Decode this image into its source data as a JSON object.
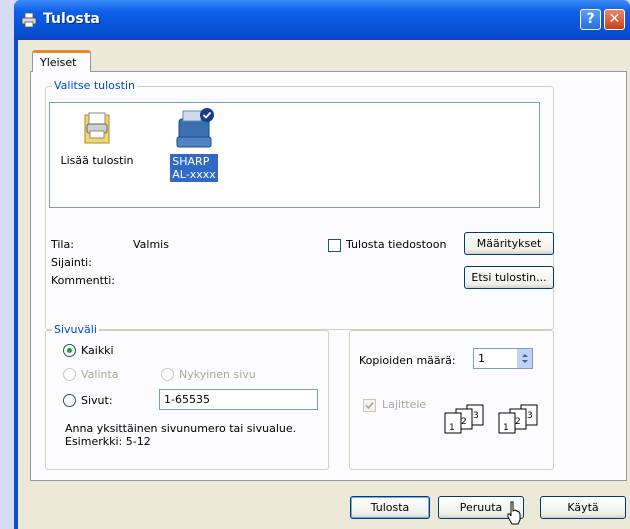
{
  "window": {
    "title": "Tulosta",
    "help_glyph": "?",
    "close_glyph": "✕"
  },
  "tabs": [
    "Yleiset"
  ],
  "printer_group": {
    "legend": "Valitse tulostin",
    "printers": [
      {
        "name": "Lisää tulostin",
        "icon": "add-printer-icon",
        "selected": false
      },
      {
        "name": "SHARP AL-xxxx",
        "line1": "SHARP",
        "line2": "AL-xxxx",
        "icon": "printer-icon",
        "selected": true,
        "default": true
      }
    ],
    "status_label": "Tila:",
    "status_value": "Valmis",
    "location_label": "Sijainti:",
    "location_value": "",
    "comment_label": "Kommentti:",
    "comment_value": "",
    "print_to_file_label": "Tulosta tiedostoon",
    "print_to_file_checked": false,
    "preferences_button": "Määritykset",
    "find_printer_button": "Etsi tulostin..."
  },
  "page_range": {
    "legend": "Sivuväli",
    "all_label": "Kaikki",
    "all_selected": true,
    "selection_label": "Valinta",
    "current_page_label": "Nykyinen sivu",
    "pages_label": "Sivut:",
    "pages_value": "1-65535",
    "hint_line1": "Anna yksittäinen sivunumero tai sivualue.",
    "hint_line2": "Esimerkki: 5-12"
  },
  "copies": {
    "label": "Kopioiden määrä:",
    "value": "1",
    "collate_label": "Lajittele",
    "collate_checked": true,
    "collate_pages": [
      "1",
      "2",
      "3"
    ]
  },
  "buttons": {
    "print": "Tulosta",
    "cancel": "Peruuta",
    "apply": "Käytä"
  },
  "colors": {
    "titlebar": "#0a4fd6",
    "tab_accent": "#e68b2c",
    "group_legend": "#0046d5",
    "selection": "#316ac5"
  }
}
